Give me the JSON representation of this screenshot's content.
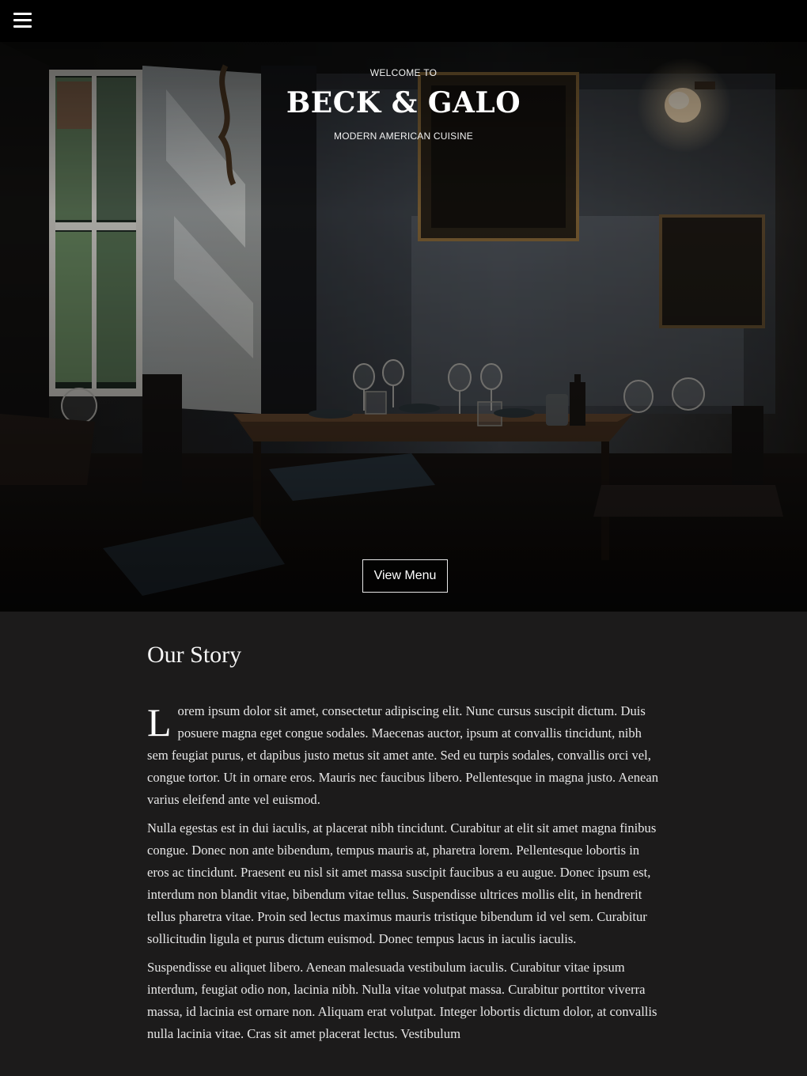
{
  "nav": {
    "menu_icon": "hamburger-icon"
  },
  "hero": {
    "welcome": "WELCOME TO",
    "brand": "BECK & GALO",
    "tagline": "MODERN AMERICAN CUISINE",
    "cta_label": "View Menu",
    "image": "dim-restaurant-interior-photo"
  },
  "story": {
    "title": "Our Story",
    "dropcap": "L",
    "p1_rest": "orem ipsum dolor sit amet, consectetur adipiscing elit. Nunc cursus suscipit dictum. Duis posuere magna eget congue sodales. Maecenas auctor, ipsum at convallis tincidunt, nibh sem feugiat purus, et dapibus justo metus sit amet ante. Sed eu turpis sodales, convallis orci vel, congue tortor. Ut in ornare eros. Mauris nec faucibus libero. Pellentesque in magna justo. Aenean varius eleifend ante vel euismod.",
    "p2": "Nulla egestas est in dui iaculis, at placerat nibh tincidunt. Curabitur at elit sit amet magna finibus congue. Donec non ante bibendum, tempus mauris at, pharetra lorem. Pellentesque lobortis in eros ac tincidunt. Praesent eu nisl sit amet massa suscipit faucibus a eu augue. Donec ipsum est, interdum non blandit vitae, bibendum vitae tellus. Suspendisse ultrices mollis elit, in hendrerit tellus pharetra vitae. Proin sed lectus maximus mauris tristique bibendum id vel sem. Curabitur sollicitudin ligula et purus dictum euismod. Donec tempus lacus in iaculis iaculis.",
    "p3": "Suspendisse eu aliquet libero. Aenean malesuada vestibulum iaculis. Curabitur vitae ipsum interdum, feugiat odio non, lacinia nibh. Nulla vitae volutpat massa. Curabitur porttitor viverra massa, id lacinia est ornare non. Aliquam erat volutpat. Integer lobortis dictum dolor, at convallis nulla lacinia vitae. Cras sit amet placerat lectus. Vestibulum"
  },
  "colors": {
    "topbar": "#000000",
    "story_bg": "#1c1b1b",
    "text": "#e6e6e6"
  }
}
